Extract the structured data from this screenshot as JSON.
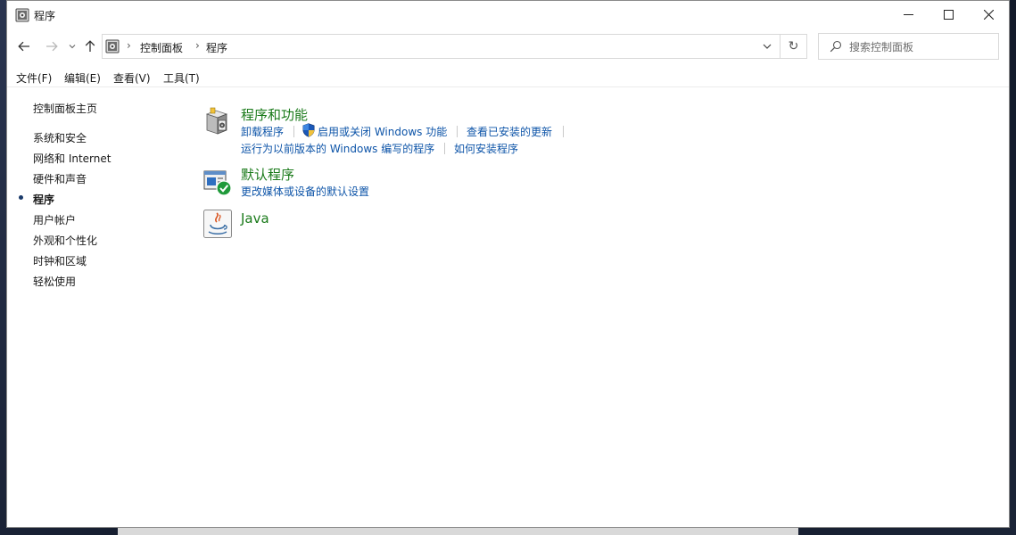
{
  "window": {
    "title": "程序",
    "icons": {
      "app": "control-panel-icon",
      "min": "minimize-icon",
      "max": "maximize-icon",
      "close": "close-icon"
    }
  },
  "nav": {
    "icons": {
      "back": "back-arrow-icon",
      "forward": "forward-arrow-icon",
      "recent": "chevron-down-icon",
      "up": "up-arrow-icon"
    },
    "breadcrumbs": [
      "控制面板",
      "程序"
    ],
    "refresh_glyph": "↻",
    "search": {
      "placeholder": "搜索控制面板",
      "value": ""
    }
  },
  "menubar": {
    "items": [
      "文件(F)",
      "编辑(E)",
      "查看(V)",
      "工具(T)"
    ]
  },
  "sidebar": {
    "home": "控制面板主页",
    "items": [
      "系统和安全",
      "网络和 Internet",
      "硬件和声音",
      "程序",
      "用户帐户",
      "外观和个性化",
      "时钟和区域",
      "轻松使用"
    ],
    "current": "程序"
  },
  "categories": [
    {
      "title": "程序和功能",
      "icon": "programs-features-icon",
      "links": [
        "卸载程序",
        "启用或关闭 Windows 功能",
        "查看已安装的更新",
        "运行为以前版本的 Windows 编写的程序",
        "如何安装程序"
      ]
    },
    {
      "title": "默认程序",
      "icon": "default-programs-icon",
      "links": [
        "更改媒体或设备的默认设置"
      ]
    },
    {
      "title": "Java",
      "icon": "java-icon",
      "links": []
    }
  ],
  "colors": {
    "category_title": "#1a7a1a",
    "link": "#0d54a8",
    "border": "#d9d9d9"
  }
}
